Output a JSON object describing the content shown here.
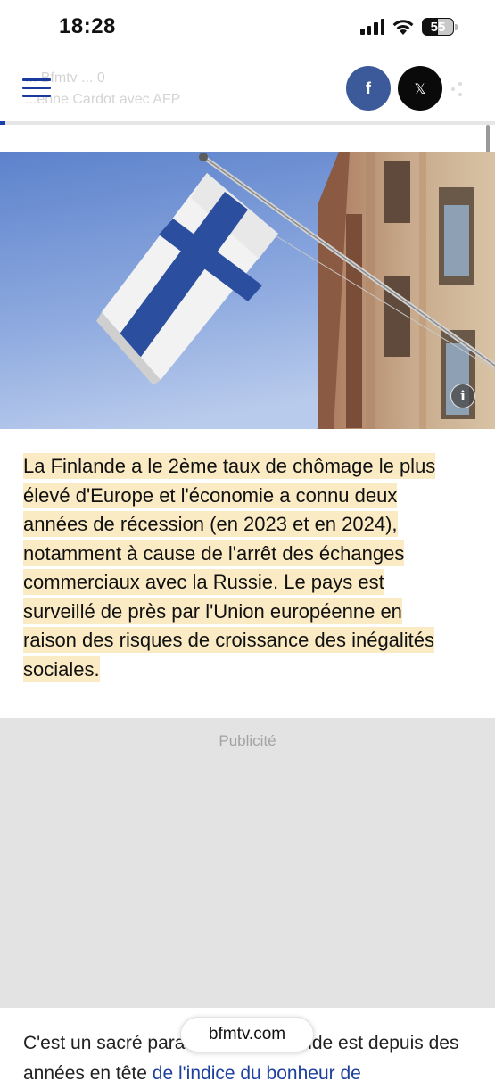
{
  "status_bar": {
    "time": "18:28",
    "battery": "55",
    "icons": [
      "signal-icon",
      "wifi-icon",
      "battery-icon"
    ]
  },
  "header": {
    "ghost_line1": "... Bfmtv ... 0",
    "ghost_line2": "...enne Cardot avec AFP",
    "menu_icon": "hamburger-menu-icon",
    "share_facebook_glyph": "f",
    "share_x_glyph": "𝕏",
    "colors": {
      "menu": "#1b3a9e",
      "facebook": "#3c5a99",
      "x": "#0a0a0a",
      "progress": "#1f3fb0"
    },
    "reading_progress_fraction": 0.01
  },
  "hero": {
    "info_glyph": "i",
    "alt": "Finnish flag on a building"
  },
  "highlight": {
    "text": "La Finlande a le 2ème taux de chômage le plus élevé d'Europe et l'économie a connu deux années de récession (en 2023 et en 2024), notamment à cause de l'arrêt des échanges commerciaux avec la Russie. Le pays est surveillé de près par l'Union européenne en raison des risques de croissance des inégalités sociales.",
    "color": "#fbebc4"
  },
  "ad": {
    "label": "Publicité"
  },
  "article": {
    "para_start": "C'est un sacré paradoxe : la Finlande est depuis des années en tête ",
    "para_link": "de l'indice du bonheur de"
  },
  "browser": {
    "url": "bfmtv.com"
  }
}
